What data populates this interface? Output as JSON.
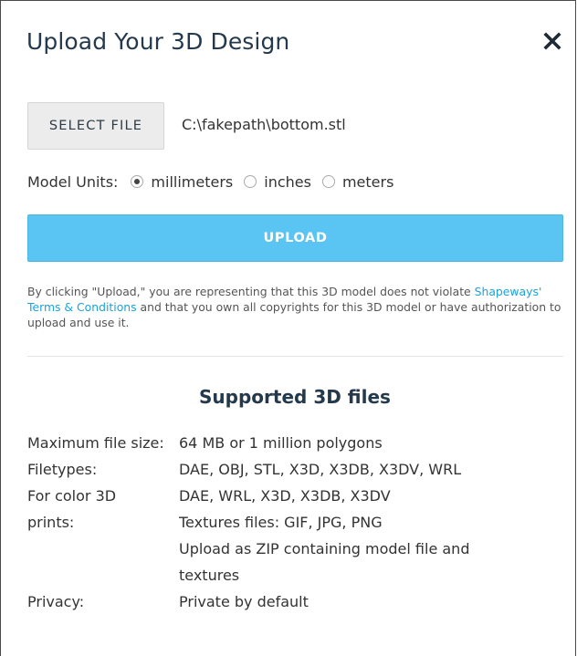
{
  "dialog": {
    "title": "Upload Your 3D Design"
  },
  "file": {
    "select_label": "SELECT FILE",
    "selected_path": "C:\\fakepath\\bottom.stl"
  },
  "units": {
    "label": "Model Units:",
    "options": [
      {
        "label": "millimeters",
        "checked": true
      },
      {
        "label": "inches",
        "checked": false
      },
      {
        "label": "meters",
        "checked": false
      }
    ]
  },
  "upload": {
    "label": "UPLOAD"
  },
  "legal": {
    "before": "By clicking \"Upload,\" you are representing that this 3D model does not violate ",
    "link": "Shapeways' Terms & Conditions",
    "after": " and that you own all copyrights for this 3D model or have authorization to upload and use it."
  },
  "supported": {
    "title": "Supported 3D files",
    "rows": [
      {
        "key": "Maximum file size:",
        "value": "64 MB or 1 million polygons"
      },
      {
        "key": "Filetypes:",
        "value": "DAE, OBJ, STL, X3D, X3DB, X3DV, WRL"
      },
      {
        "key": "For color 3D",
        "value": "DAE, WRL, X3D, X3DB, X3DV"
      },
      {
        "key": "prints:",
        "value": "Textures files: GIF, JPG, PNG"
      },
      {
        "key": "",
        "value": "Upload as ZIP containing model file and"
      },
      {
        "key": "",
        "value": "textures"
      },
      {
        "key": "Privacy:",
        "value": "Private by default"
      }
    ]
  },
  "colors": {
    "accent": "#5ac5f2",
    "link": "#1aa3dc",
    "heading": "#243a4c"
  },
  "icons": {
    "close": "close-icon"
  }
}
